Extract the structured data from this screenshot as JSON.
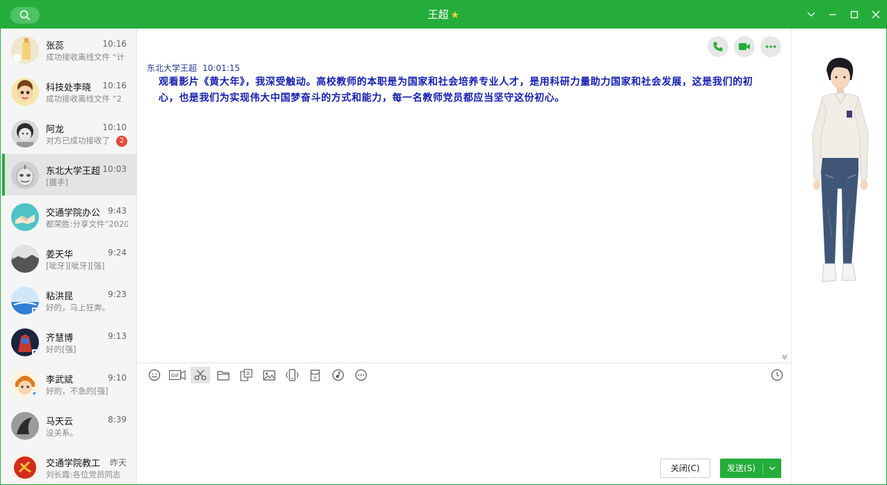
{
  "window": {
    "title": "王超",
    "title_star": "★",
    "accent": "#24ad3a"
  },
  "icons": {
    "search": "search-icon",
    "min_menu": "chevron-down-icon",
    "minimize": "minimize-icon",
    "maximize": "maximize-icon",
    "close": "close-icon"
  },
  "contacts": [
    {
      "name": "张蕊",
      "time": "10:16",
      "preview": "成功接收离线文件 “计",
      "badge": ""
    },
    {
      "name": "科技处李晓",
      "time": "10:16",
      "preview": "成功接收离线文件 “2",
      "badge": ""
    },
    {
      "name": "阿龙",
      "time": "10:10",
      "preview": "对方已成功接收了",
      "badge": "2"
    },
    {
      "name": "东北大学王超",
      "time": "10:03",
      "preview": "[握手]",
      "badge": ""
    },
    {
      "name": "交通学院办公",
      "time": "9:43",
      "preview": "都荣胜:分享文件“2020",
      "badge": ""
    },
    {
      "name": "姜天华",
      "time": "9:24",
      "preview": "[呲牙][呲牙][强]",
      "badge": ""
    },
    {
      "name": "粘洪昆",
      "time": "9:23",
      "preview": "好的，马上狂奔。",
      "badge": ""
    },
    {
      "name": "齐慧博",
      "time": "9:13",
      "preview": "好的[强]",
      "badge": ""
    },
    {
      "name": "李武斌",
      "time": "9:10",
      "preview": "好的，不急的[强]",
      "badge": ""
    },
    {
      "name": "马天云",
      "time": "8:39",
      "preview": "没关系。",
      "badge": ""
    },
    {
      "name": "交通学院教工",
      "time": "昨天",
      "preview": "刘长霞:各位党员同志",
      "badge": ""
    }
  ],
  "chat": {
    "sender": "东北大学王超",
    "timestamp": "10:01:15",
    "message": "观看影片《黄大年》，我深受触动。高校教师的本职是为国家和社会培养专业人才，是用科研力量助力国家和社会发展，这是我们的初心，也是我们为实现伟大中国梦奋斗的方式和能力，每一名教师党员都应当坚守这份初心。",
    "message_color": "#1420b0"
  },
  "toolbar": {
    "tools": [
      "emoji-icon",
      "gif-icon",
      "screenshot-scissors-icon",
      "folder-icon",
      "chat-style-icon",
      "image-icon",
      "shake-window-icon",
      "red-packet-icon",
      "music-icon",
      "more-icon"
    ],
    "gif_label": "GIF",
    "history": "clock-icon"
  },
  "buttons": {
    "close_label": "关闭(C)",
    "send_label": "发送(S)"
  },
  "input": {
    "value": ""
  }
}
